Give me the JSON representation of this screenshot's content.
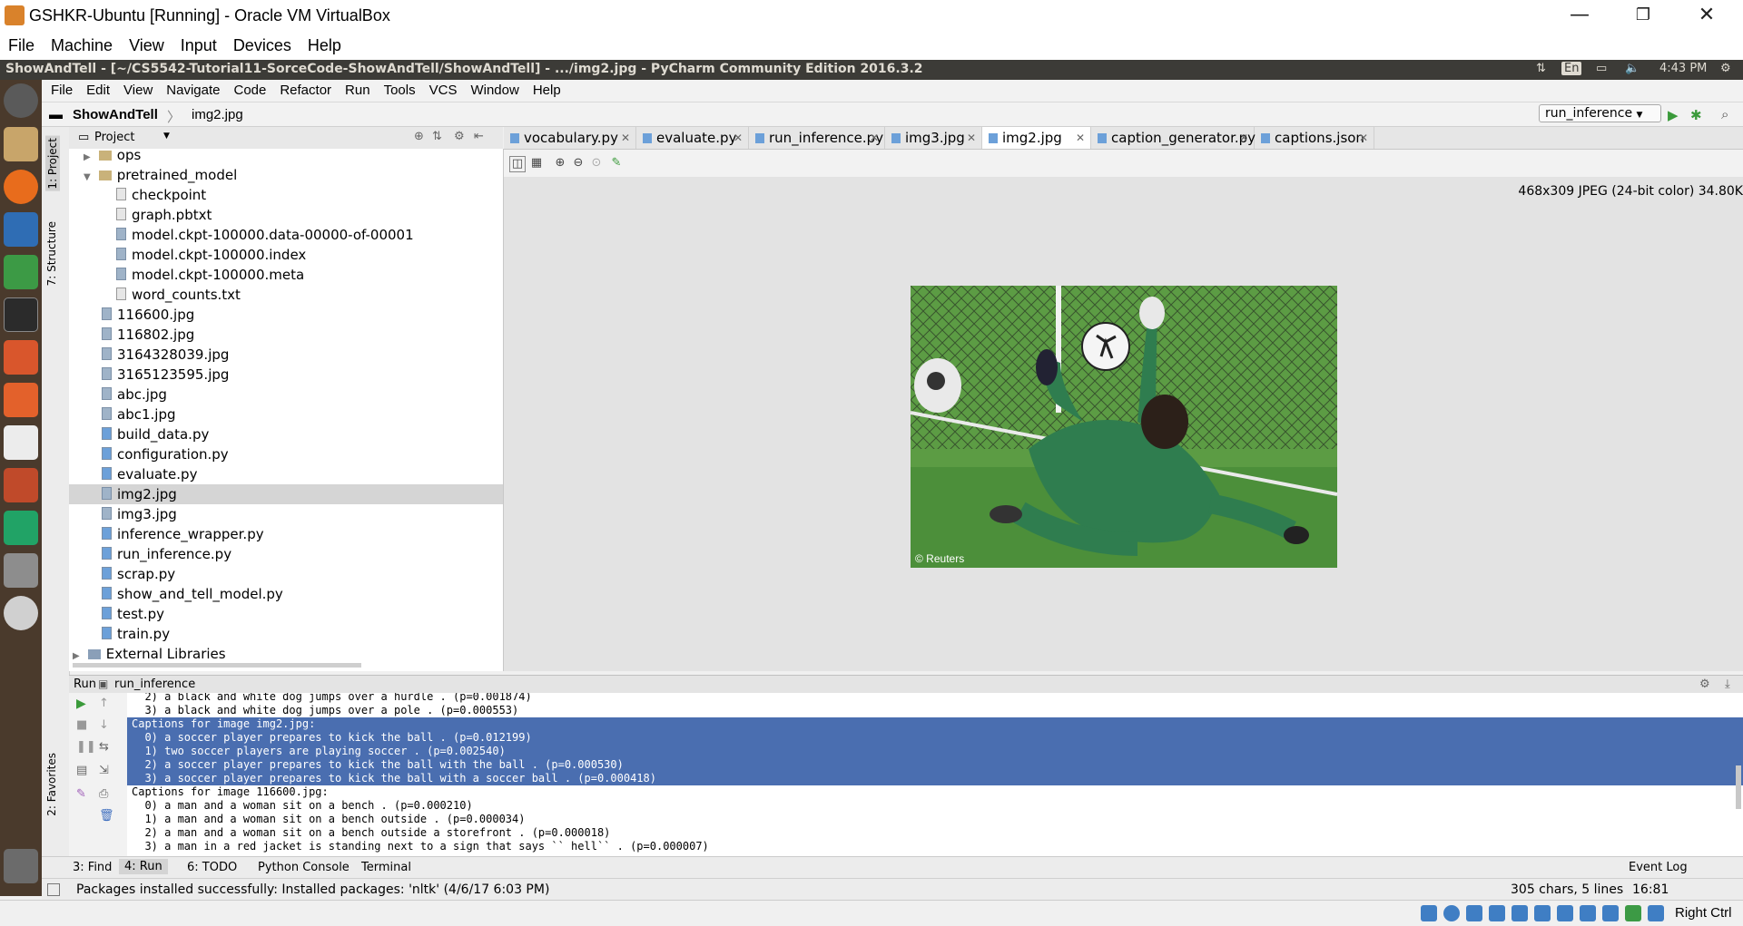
{
  "vbox": {
    "title": "GSHKR-Ubuntu [Running] - Oracle VM VirtualBox",
    "menu": [
      "File",
      "Machine",
      "View",
      "Input",
      "Devices",
      "Help"
    ],
    "status_right": "Right Ctrl"
  },
  "ubuntu_panel": {
    "window_title": "ShowAndTell - [~/CS5542-Tutorial11-SorceCode-ShowAndTell/ShowAndTell] - .../img2.jpg - PyCharm Community Edition 2016.3.2",
    "keyboard": "En",
    "clock": "4:43 PM"
  },
  "pycharm_menu": [
    "File",
    "Edit",
    "View",
    "Navigate",
    "Code",
    "Refactor",
    "Run",
    "Tools",
    "VCS",
    "Window",
    "Help"
  ],
  "navbar": {
    "project": "ShowAndTell",
    "file": "img2.jpg",
    "run_config": "run_inference"
  },
  "side_tabs": {
    "project": "1: Project",
    "structure": "7: Structure",
    "favorites": "2: Favorites"
  },
  "project_panel": {
    "header": "Project",
    "items": [
      {
        "label": "ops",
        "kind": "folder",
        "depth": 0,
        "arrow": "▶"
      },
      {
        "label": "pretrained_model",
        "kind": "folder",
        "depth": 0,
        "arrow": "▼"
      },
      {
        "label": "checkpoint",
        "kind": "txt",
        "depth": 1
      },
      {
        "label": "graph.pbtxt",
        "kind": "txt",
        "depth": 1
      },
      {
        "label": "model.ckpt-100000.data-00000-of-00001",
        "kind": "file",
        "depth": 1
      },
      {
        "label": "model.ckpt-100000.index",
        "kind": "file",
        "depth": 1
      },
      {
        "label": "model.ckpt-100000.meta",
        "kind": "file",
        "depth": 1
      },
      {
        "label": "word_counts.txt",
        "kind": "txt",
        "depth": 1
      },
      {
        "label": "116600.jpg",
        "kind": "file",
        "depth": 0
      },
      {
        "label": "116802.jpg",
        "kind": "file",
        "depth": 0
      },
      {
        "label": "3164328039.jpg",
        "kind": "file",
        "depth": 0
      },
      {
        "label": "3165123595.jpg",
        "kind": "file",
        "depth": 0
      },
      {
        "label": "abc.jpg",
        "kind": "file",
        "depth": 0
      },
      {
        "label": "abc1.jpg",
        "kind": "file",
        "depth": 0
      },
      {
        "label": "build_data.py",
        "kind": "py",
        "depth": 0
      },
      {
        "label": "configuration.py",
        "kind": "py",
        "depth": 0
      },
      {
        "label": "evaluate.py",
        "kind": "py",
        "depth": 0
      },
      {
        "label": "img2.jpg",
        "kind": "file",
        "depth": 0,
        "selected": true
      },
      {
        "label": "img3.jpg",
        "kind": "file",
        "depth": 0
      },
      {
        "label": "inference_wrapper.py",
        "kind": "py",
        "depth": 0
      },
      {
        "label": "run_inference.py",
        "kind": "py",
        "depth": 0
      },
      {
        "label": "scrap.py",
        "kind": "py",
        "depth": 0
      },
      {
        "label": "show_and_tell_model.py",
        "kind": "py",
        "depth": 0
      },
      {
        "label": "test.py",
        "kind": "py",
        "depth": 0
      },
      {
        "label": "train.py",
        "kind": "py",
        "depth": 0
      },
      {
        "label": "External Libraries",
        "kind": "lib",
        "depth": -1,
        "arrow": "▶"
      }
    ]
  },
  "editor_tabs": [
    {
      "label": "vocabulary.py",
      "active": false
    },
    {
      "label": "evaluate.py",
      "active": false
    },
    {
      "label": "run_inference.py",
      "active": false
    },
    {
      "label": "img3.jpg",
      "active": false
    },
    {
      "label": "img2.jpg",
      "active": true
    },
    {
      "label": "caption_generator.py",
      "active": false
    },
    {
      "label": "captions.json",
      "active": false
    }
  ],
  "image_viewer": {
    "info": "468x309 JPEG (24-bit color) 34.80K",
    "watermark": "© Reuters"
  },
  "run_panel": {
    "label": "Run",
    "config": "run_inference",
    "lines": [
      {
        "text": "  2) a black and white dog jumps over a hurdle . (p=0.001874)",
        "selected": false
      },
      {
        "text": "  3) a black and white dog jumps over a pole . (p=0.000553)",
        "selected": false
      },
      {
        "text": "Captions for image img2.jpg:",
        "selected": true
      },
      {
        "text": "  0) a soccer player prepares to kick the ball . (p=0.012199)",
        "selected": true
      },
      {
        "text": "  1) two soccer players are playing soccer . (p=0.002540)",
        "selected": true
      },
      {
        "text": "  2) a soccer player prepares to kick the ball with the ball . (p=0.000530)",
        "selected": true
      },
      {
        "text": "  3) a soccer player prepares to kick the ball with a soccer ball . (p=0.000418)",
        "selected": true
      },
      {
        "text": "Captions for image 116600.jpg:",
        "selected": false
      },
      {
        "text": "  0) a man and a woman sit on a bench . (p=0.000210)",
        "selected": false
      },
      {
        "text": "  1) a man and a woman sit on a bench outside . (p=0.000034)",
        "selected": false
      },
      {
        "text": "  2) a man and a woman sit on a bench outside a storefront . (p=0.000018)",
        "selected": false
      },
      {
        "text": "  3) a man in a red jacket is standing next to a sign that says `` hell`` . (p=0.000007)",
        "selected": false
      }
    ]
  },
  "tool_tabs": {
    "find": "3: Find",
    "run": "4: Run",
    "todo": "6: TODO",
    "python_console": "Python Console",
    "terminal": "Terminal",
    "event_log": "Event Log"
  },
  "status": {
    "message": "Packages installed successfully: Installed packages: 'nltk' (4/6/17 6:03 PM)",
    "chars": "305 chars, 5 lines",
    "position": "16:81"
  },
  "colors": {
    "selection": "#4a6eb0",
    "ubuntu_panel": "#3c3b37",
    "launcher": "#4a3a2c",
    "pitch": "#4c8f3a",
    "goalkeeper": "#2f7d4f"
  }
}
